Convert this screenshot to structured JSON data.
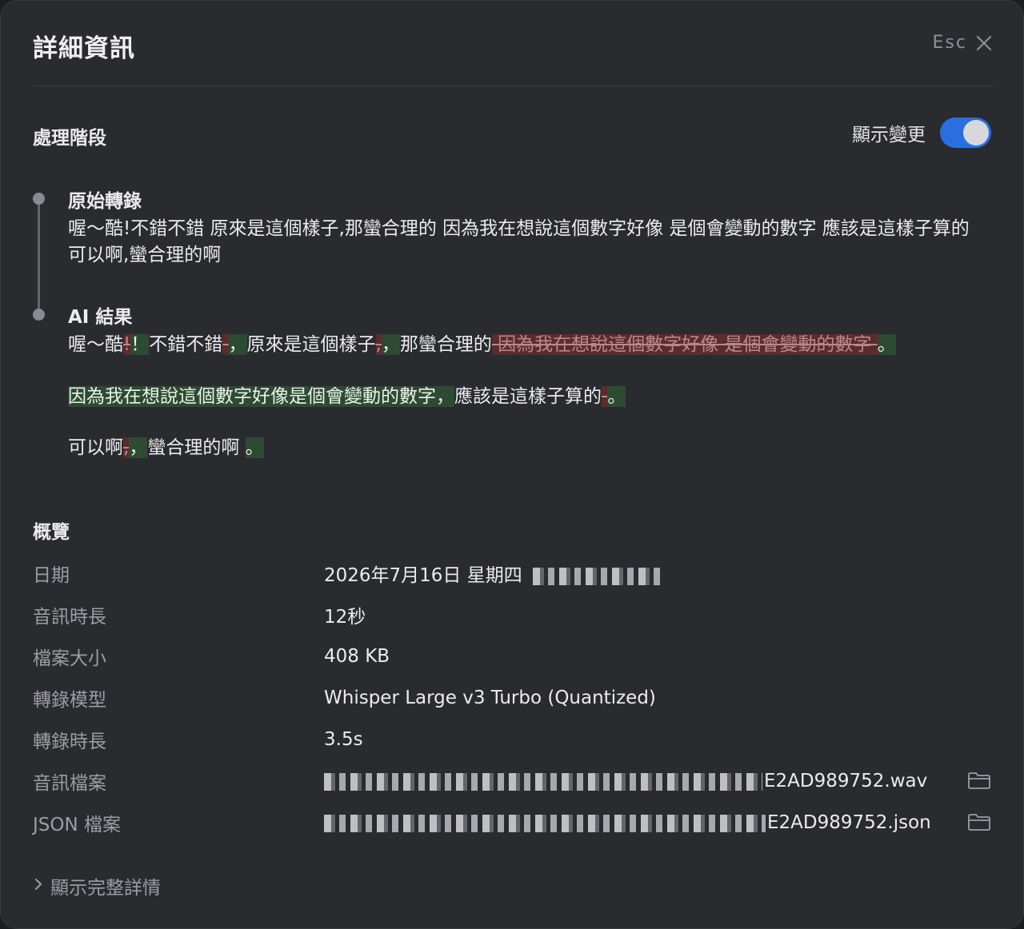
{
  "dialog": {
    "title": "詳細資訊",
    "esc_label": "Esc"
  },
  "stages": {
    "section_title": "處理階段",
    "toggle_label": "顯示變更",
    "toggle_on": true,
    "original": {
      "title": "原始轉錄",
      "text": "喔～酷!不錯不錯 原來是這個樣子,那蠻合理的 因為我在想說這個數字好像 是個會變動的數字 應該是這樣子算的 可以啊,蠻合理的啊"
    },
    "ai": {
      "title": "AI 結果",
      "line1": [
        {
          "t": "喔～酷",
          "k": "eq"
        },
        {
          "t": "!",
          "k": "del"
        },
        {
          "t": "！",
          "k": "ins"
        },
        {
          "t": "不錯不錯",
          "k": "eq"
        },
        {
          "t": " ",
          "k": "del"
        },
        {
          "t": "，",
          "k": "ins"
        },
        {
          "t": "原來是這個樣子",
          "k": "eq"
        },
        {
          "t": ",",
          "k": "del"
        },
        {
          "t": "，",
          "k": "ins"
        },
        {
          "t": "那蠻合理的",
          "k": "eq"
        },
        {
          "t": " 因為我在想說這個數字好像 是個會變動的數字 ",
          "k": "del"
        },
        {
          "t": "。",
          "k": "ins"
        }
      ],
      "line2": [
        {
          "t": "因為我在想說這個數字好像是個會變動的數字，",
          "k": "ins"
        },
        {
          "t": "應該是這樣子算的",
          "k": "eq"
        },
        {
          "t": " ",
          "k": "del"
        },
        {
          "t": "。",
          "k": "ins"
        }
      ],
      "line3": [
        {
          "t": "可以啊",
          "k": "eq"
        },
        {
          "t": ",",
          "k": "del"
        },
        {
          "t": "，",
          "k": "ins"
        },
        {
          "t": "蠻合理的啊",
          "k": "eq"
        },
        {
          "t": " ",
          "k": "eq"
        },
        {
          "t": "。",
          "k": "ins"
        }
      ]
    }
  },
  "overview": {
    "section_title": "概覽",
    "rows": [
      {
        "label": "日期",
        "value": "2026年7月16日 星期四"
      },
      {
        "label": "音訊時長",
        "value": "12秒"
      },
      {
        "label": "檔案大小",
        "value": "408 KB"
      },
      {
        "label": "轉錄模型",
        "value": "Whisper Large v3 Turbo (Quantized)"
      },
      {
        "label": "轉錄時長",
        "value": "3.5s"
      },
      {
        "label": "音訊檔案",
        "value": "E2AD989752.wav"
      },
      {
        "label": "JSON 檔案",
        "value": "E2AD989752.json"
      }
    ]
  },
  "footer": {
    "show_details": "顯示完整詳情"
  },
  "icons": {
    "close": "close-icon",
    "folder": "folder-icon",
    "chevron": "chevron-right-icon"
  },
  "colors": {
    "toggle_on": "#2a6fe0",
    "insert_bg": "#2d4b32",
    "delete_bg": "#5a2c2e"
  }
}
